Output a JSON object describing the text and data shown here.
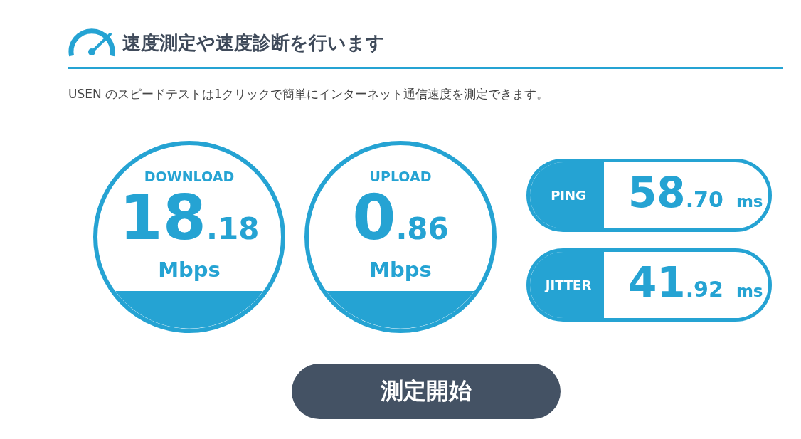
{
  "header": {
    "title": "速度測定や速度診断を行います",
    "description": "USEN のスピードテストは1クリックで簡単にインターネット通信速度を測定できます。"
  },
  "speed_meters": [
    {
      "label": "DOWNLOAD",
      "value_whole": "18",
      "value_fraction": ".18",
      "unit": "Mbps"
    },
    {
      "label": "UPLOAD",
      "value_whole": "0",
      "value_fraction": ".86",
      "unit": "Mbps"
    }
  ],
  "latency_meters": [
    {
      "label": "PING",
      "value_whole": "58",
      "value_fraction": ".70",
      "unit": "ms"
    },
    {
      "label": "JITTER",
      "value_whole": "41",
      "value_fraction": ".92",
      "unit": "ms"
    }
  ],
  "start_button": {
    "label": "測定開始"
  }
}
